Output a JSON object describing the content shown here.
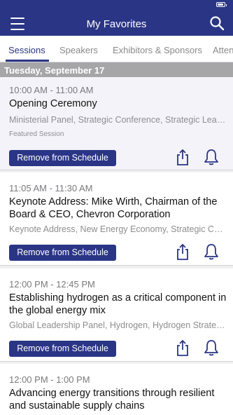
{
  "header": {
    "title": "My Favorites",
    "menu_icon": "hamburger-icon",
    "search_icon": "search-icon"
  },
  "tabs": [
    {
      "label": "Sessions",
      "active": true
    },
    {
      "label": "Speakers",
      "active": false
    },
    {
      "label": "Exhibitors & Sponsors",
      "active": false
    },
    {
      "label": "Atten",
      "active": false
    }
  ],
  "date_header": "Tuesday, September 17",
  "sessions": [
    {
      "time": "10:00 AM - 11:00 AM",
      "title": "Opening Ceremony",
      "tags": "Ministerial Panel, Strategic Conference, Strategic Lead...",
      "featured_label": "Featured Session",
      "button_label": "Remove from Schedule"
    },
    {
      "time": "11:05 AM - 11:30 AM",
      "title": "Keynote Address: Mike Wirth, Chairman of the Board & CEO, Chevron Corporation",
      "tags": "Keynote Address, New Energy Economy, Strategic Co...",
      "button_label": "Remove from Schedule"
    },
    {
      "time": "12:00 PM - 12:45 PM",
      "title": "Establishing hydrogen as a critical component in the global energy mix",
      "tags": "Global Leadership Panel, Hydrogen, Hydrogen Strateg...",
      "button_label": "Remove from Schedule"
    },
    {
      "time": "12:00 PM - 1:00 PM",
      "title": "Advancing energy transitions through resilient and sustainable supply chains"
    }
  ],
  "colors": {
    "primary": "#2a3585",
    "date_header_bg": "#a6a6a9",
    "featured_bg": "#f5f3fa"
  }
}
